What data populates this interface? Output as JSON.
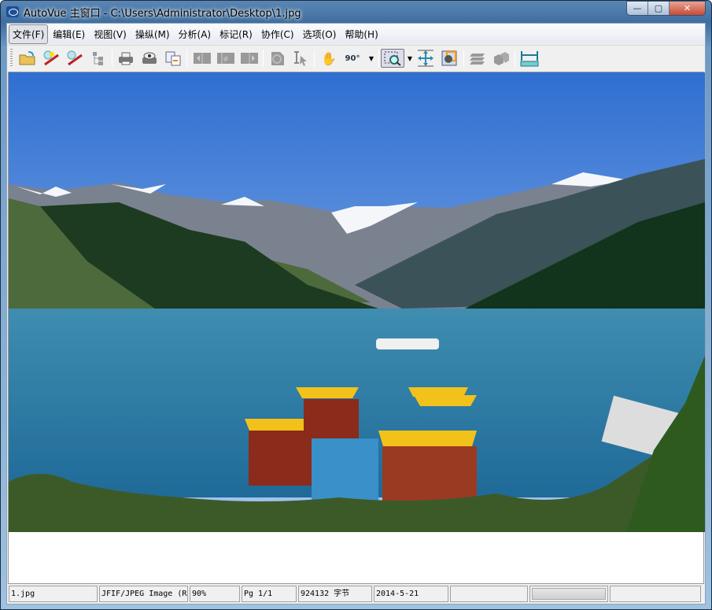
{
  "window": {
    "title": "AutoVue 主窗口 - C:\\Users\\Administrator\\Desktop\\1.jpg",
    "minimize": "—",
    "maximize": "▢",
    "close": "✕"
  },
  "menu": [
    "文件(F)",
    "编辑(E)",
    "视图(V)",
    "操纵(M)",
    "分析(A)",
    "标记(R)",
    "协作(C)",
    "选项(O)",
    "帮助(H)"
  ],
  "toolbar": {
    "rotate_label": "90°"
  },
  "status": {
    "file": "1.jpg",
    "type": "JFIF/JPEG Image (R",
    "zoom": "90%",
    "page": "Pg 1/1",
    "size": "924132 字节",
    "date": "2014-5-21",
    "extra1": "",
    "extra2": ""
  }
}
